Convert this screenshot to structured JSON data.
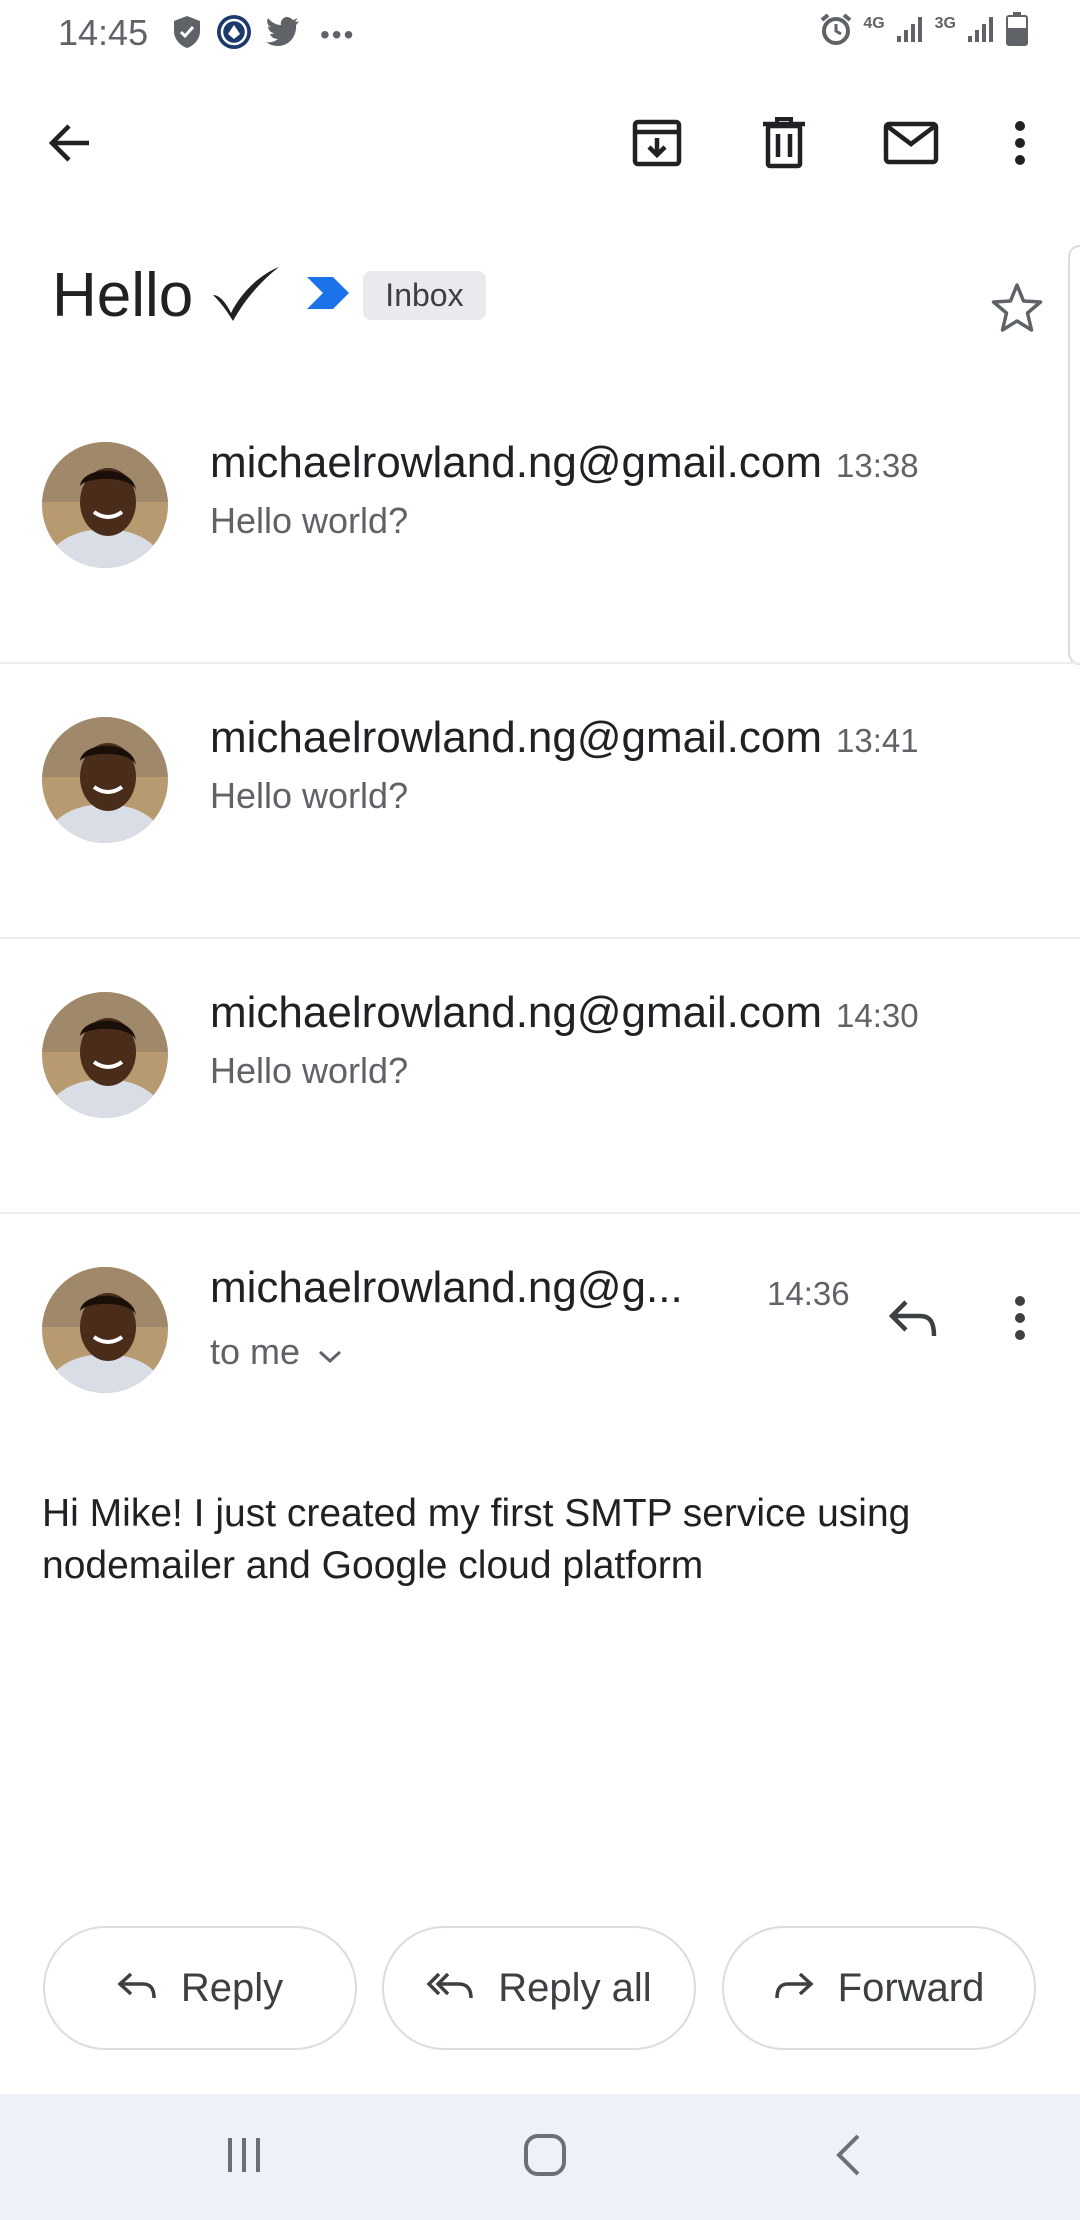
{
  "status_bar": {
    "time": "14:45",
    "left_icons": [
      "shield-icon",
      "crypto-app-icon",
      "twitter-icon",
      "more-notifications-icon"
    ],
    "network_1": "4G",
    "network_2": "3G",
    "right_icons": [
      "alarm-icon",
      "signal-icon",
      "signal-icon",
      "battery-icon"
    ]
  },
  "toolbar": {
    "back_icon": "arrow-left-icon",
    "archive_icon": "archive-icon",
    "delete_icon": "trash-icon",
    "mark_unread_icon": "mail-icon",
    "more_icon": "more-vertical-icon"
  },
  "thread": {
    "subject": "Hello",
    "label": "Inbox",
    "colors": {
      "importance_marker": "#1a73e8",
      "chip_bg": "#e8eaed"
    }
  },
  "messages": [
    {
      "sender": "michaelrowland.ng@gmail.com",
      "time": "13:38",
      "snippet": "Hello world?"
    },
    {
      "sender": "michaelrowland.ng@gmail.com",
      "time": "13:41",
      "snippet": "Hello world?"
    },
    {
      "sender": "michaelrowland.ng@gmail.com",
      "time": "14:30",
      "snippet": "Hello world?"
    }
  ],
  "open_message": {
    "sender": "michaelrowland.ng@g...",
    "time": "14:36",
    "recipient": "to me",
    "body": "Hi Mike! I just created my first SMTP service using nodemailer and Google cloud platform"
  },
  "actions": {
    "reply": "Reply",
    "reply_all": "Reply all",
    "forward": "Forward"
  },
  "nav": {
    "recents_icon": "recents-icon",
    "home_icon": "home-icon",
    "back_icon": "nav-back-icon"
  }
}
